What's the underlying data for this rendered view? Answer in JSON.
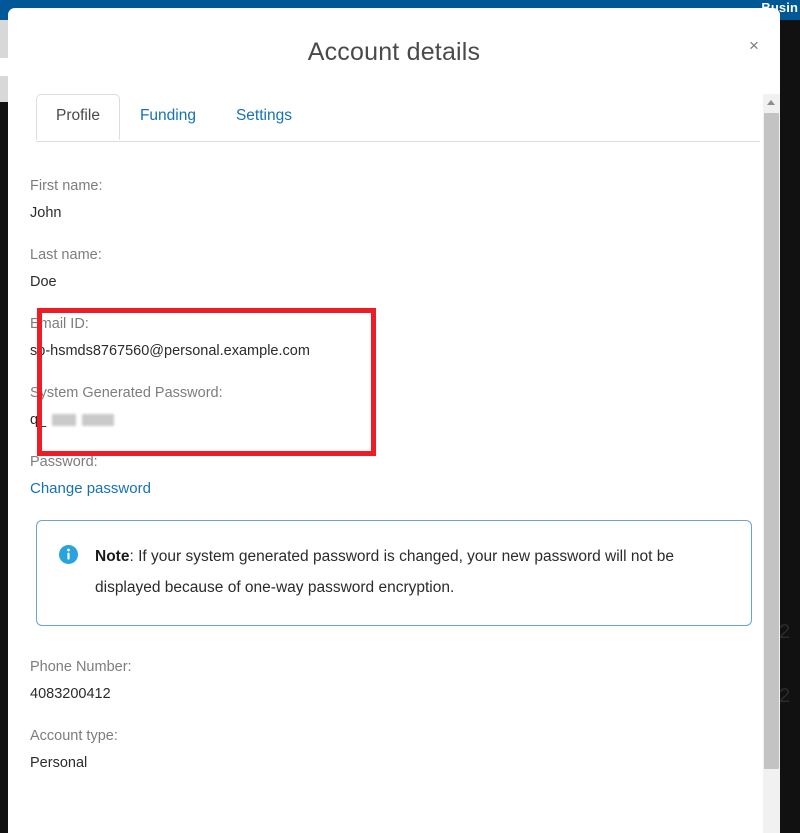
{
  "background": {
    "topbar_label": "Busin",
    "topbar_color": "#005896",
    "ghost_text": "2 2"
  },
  "modal": {
    "title": "Account details",
    "close_label": "×"
  },
  "tabs": [
    {
      "label": "Profile",
      "active": true
    },
    {
      "label": "Funding",
      "active": false
    },
    {
      "label": "Settings",
      "active": false
    }
  ],
  "profile": {
    "first_name": {
      "label": "First name:",
      "value": "John"
    },
    "last_name": {
      "label": "Last name:",
      "value": "Doe"
    },
    "email_id": {
      "label": "Email ID:",
      "value": "sb-hsmds8767560@personal.example.com"
    },
    "system_password": {
      "label": "System Generated Password:",
      "visible_prefix": "q_",
      "redacted": true
    },
    "password": {
      "label": "Password:",
      "change_link": "Change password"
    },
    "phone_number": {
      "label": "Phone Number:",
      "value": "4083200412"
    },
    "account_type": {
      "label": "Account type:",
      "value": "Personal"
    }
  },
  "note": {
    "icon": "info-icon",
    "label": "Note",
    "text": ": If your system generated password is changed, your new password will not be displayed because of one-way password encryption.",
    "border_color": "#6ba5cf",
    "icon_color": "#29a3dd"
  },
  "annotation": {
    "highlight_color": "#ee1c25",
    "highlights": "Email ID and System Generated Password"
  },
  "colors": {
    "link": "#1573b5",
    "label_grey": "#7d7d7d",
    "value_dark": "#2b2b2b"
  }
}
